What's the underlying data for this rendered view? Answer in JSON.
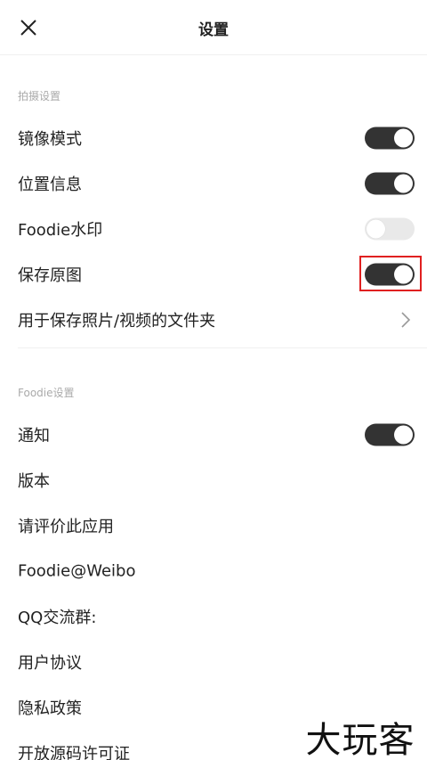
{
  "header": {
    "title": "设置",
    "close_icon": "close-icon"
  },
  "sections": [
    {
      "title": "拍摄设置",
      "rows": [
        {
          "label": "镜像模式",
          "control": "toggle",
          "on": true
        },
        {
          "label": "位置信息",
          "control": "toggle",
          "on": true
        },
        {
          "label": "Foodie水印",
          "control": "toggle",
          "on": false
        },
        {
          "label": "保存原图",
          "control": "toggle",
          "on": true,
          "highlighted": true
        },
        {
          "label": "用于保存照片/视频的文件夹",
          "control": "chevron",
          "icon": "chevron-right-icon"
        }
      ]
    },
    {
      "title": "Foodie设置",
      "rows": [
        {
          "label": "通知",
          "control": "toggle",
          "on": true
        },
        {
          "label": "版本"
        },
        {
          "label": "请评价此应用"
        },
        {
          "label": "Foodie@Weibo"
        },
        {
          "label": "QQ交流群:"
        },
        {
          "label": "用户协议"
        },
        {
          "label": "隐私政策"
        },
        {
          "label": "开放源码许可证"
        }
      ]
    }
  ],
  "watermark": {
    "text": "大玩客"
  },
  "colors": {
    "toggle_on": "#333333",
    "toggle_off": "#e9e9e9",
    "highlight": "#e02020",
    "section_title": "#aaaaaa"
  }
}
